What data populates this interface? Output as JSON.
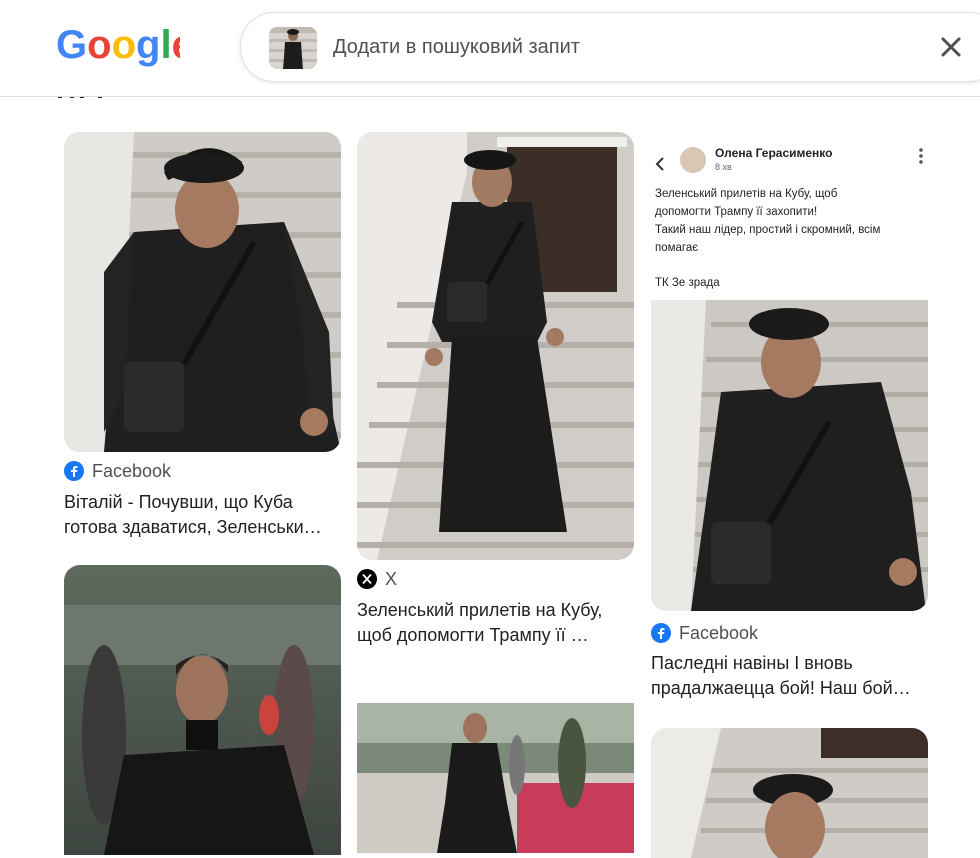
{
  "header": {
    "logo_text": "Google",
    "search_placeholder": "Додати в пошуковий запит"
  },
  "results": [
    {
      "source": "Facebook",
      "source_icon": "facebook-icon",
      "caption": "Віталій - Почувши, що Куба готова здаватися, Зеленськи…"
    },
    {
      "source": "X",
      "source_icon": "x-icon",
      "caption": "Зеленський прилетів на Кубу, щоб допомогти Трампу її …"
    },
    {
      "source": "Facebook",
      "source_icon": "facebook-icon",
      "caption": "Паслeднi навiны І вновь прадалжаецца бой! Наш бой…",
      "embedded_post": {
        "author": "Олена Герасименко",
        "time": "8 хв",
        "text_line1": "Зеленський прилетів на Кубу, щоб",
        "text_line2": "допомогти Трампу її захопити!",
        "text_line3": "Такий наш лідер, простий і скромний, всім",
        "text_line4": "помагає",
        "tag": "ТК Зе зрада"
      }
    }
  ],
  "colors": {
    "facebook_blue": "#1877f2",
    "coat": "#1e1e1e",
    "stairs": "#c9c5c0"
  }
}
